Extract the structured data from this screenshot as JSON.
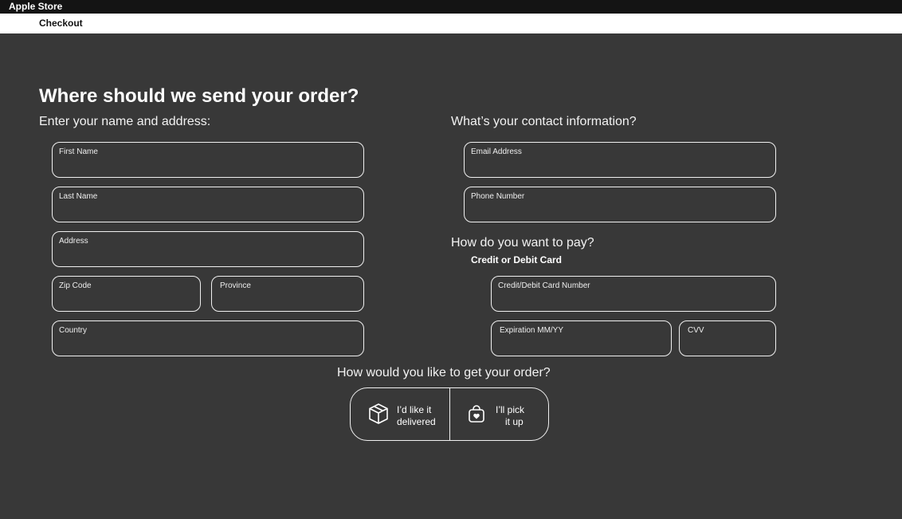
{
  "app": {
    "title": "Apple Store"
  },
  "breadcrumb": {
    "label": "Checkout"
  },
  "page": {
    "heading": "Where should we send your order?"
  },
  "address": {
    "heading": "Enter your name and address:",
    "fields": {
      "first_name": "First Name",
      "last_name": "Last Name",
      "address": "Address",
      "zip": "Zip Code",
      "province": "Province",
      "country": "Country"
    }
  },
  "contact": {
    "heading": "What’s your contact information?",
    "fields": {
      "email": "Email Address",
      "phone": "Phone Number"
    }
  },
  "payment": {
    "heading": "How do you want to pay?",
    "method": "Credit or Debit Card",
    "fields": {
      "card_number": "Credit/Debit Card Number",
      "expiration": "Expiration MM/YY",
      "cvv": "CVV"
    }
  },
  "fulfillment": {
    "heading": "How would you like to get your order?",
    "options": [
      {
        "line1": "I’d like it",
        "line2": "delivered",
        "icon": "box-icon"
      },
      {
        "line1": "I’ll pick",
        "line2": "it up",
        "icon": "shopping-bag-heart-icon"
      }
    ]
  }
}
